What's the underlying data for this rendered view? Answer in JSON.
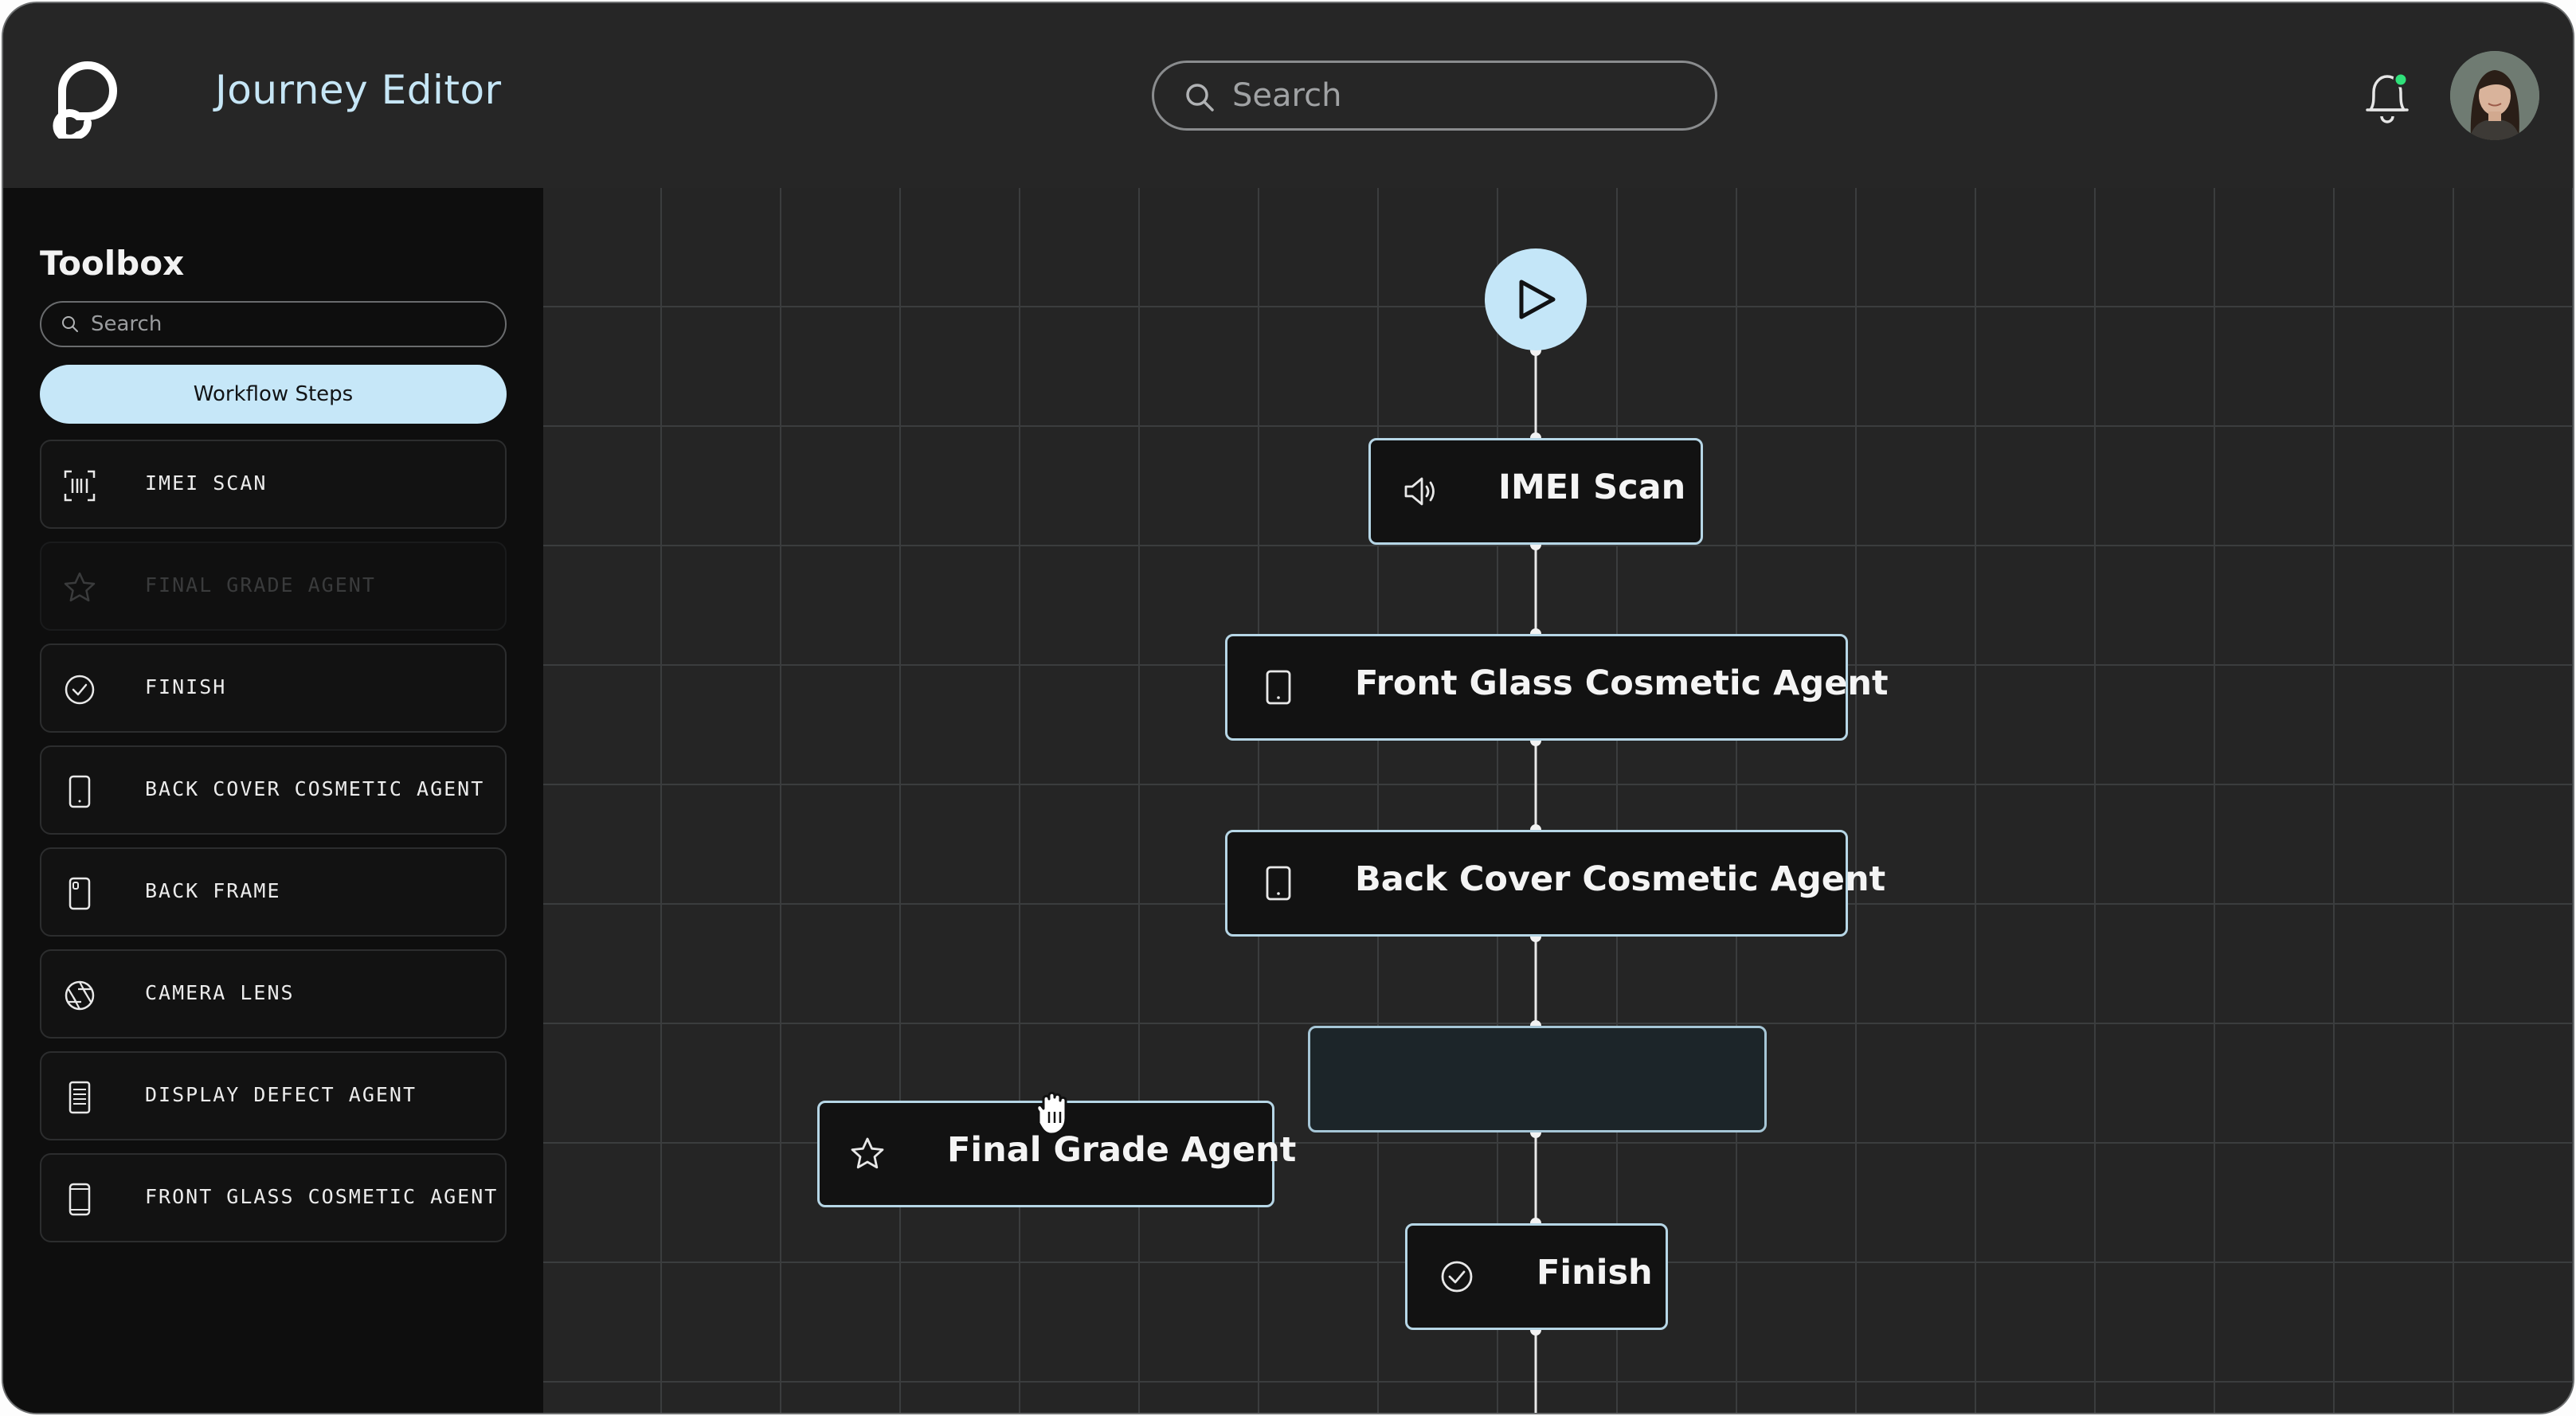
{
  "header": {
    "logo_icon": "brand-logo-icon",
    "title": "Journey Editor",
    "search_placeholder": "Search",
    "notification_icon": "bell-icon",
    "notification_dot_color": "#2fe07a",
    "avatar_icon": "user-avatar"
  },
  "toolbox": {
    "title": "Toolbox",
    "search_placeholder": "Search",
    "active_tab": "Workflow Steps",
    "items": [
      {
        "label": "IMEI SCAN",
        "icon": "barcode-icon",
        "dimmed": false
      },
      {
        "label": "FINAL GRADE AGENT",
        "icon": "star-icon",
        "dimmed": true
      },
      {
        "label": "FINISH",
        "icon": "check-circle-icon",
        "dimmed": false
      },
      {
        "label": "BACK COVER COSMETIC AGENT",
        "icon": "phone-icon",
        "dimmed": false
      },
      {
        "label": "BACK FRAME",
        "icon": "phone-camera-icon",
        "dimmed": false
      },
      {
        "label": "CAMERA LENS",
        "icon": "aperture-icon",
        "dimmed": false
      },
      {
        "label": "DISPLAY DEFECT AGENT",
        "icon": "display-icon",
        "dimmed": false
      },
      {
        "label": "FRONT GLASS COSMETIC AGENT",
        "icon": "phone-icon",
        "dimmed": false
      }
    ]
  },
  "workflow": {
    "start_icon": "play-icon",
    "nodes": [
      {
        "label": "IMEI Scan",
        "icon": "speaker-icon"
      },
      {
        "label": "Front Glass Cosmetic Agent",
        "icon": "phone-icon"
      },
      {
        "label": "Back Cover Cosmetic Agent",
        "icon": "phone-icon"
      },
      {
        "label": "Finish",
        "icon": "check-circle-icon"
      }
    ],
    "drop_placeholder": "",
    "dragging_node": {
      "label": "Final Grade Agent",
      "icon": "star-icon"
    },
    "cursor_icon": "grab-hand-icon"
  },
  "colors": {
    "accent": "#c6e7f8",
    "background": "#242424",
    "sidebar": "#0e0e0e",
    "node_border": "#b6d6e6"
  }
}
